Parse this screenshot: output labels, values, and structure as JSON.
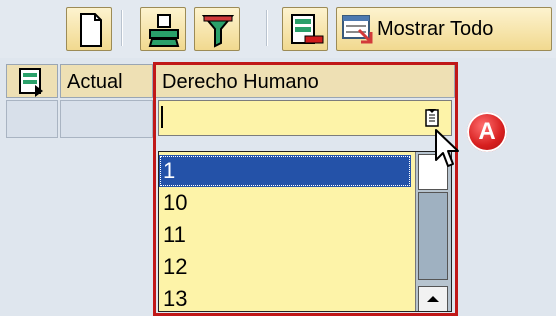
{
  "toolbar": {
    "buttons": [
      {
        "name": "new-document",
        "icon": "document-icon"
      },
      {
        "name": "print",
        "icon": "printer-icon"
      },
      {
        "name": "filter",
        "icon": "filter-icon"
      },
      {
        "name": "layout",
        "icon": "layout-icon"
      },
      {
        "name": "show-all",
        "icon": "show-all-icon",
        "label": "Mostrar Todo"
      }
    ]
  },
  "grid": {
    "columns": [
      "Actual",
      "Derecho Humano"
    ],
    "row_selector_icon": "row-select-icon"
  },
  "dropdown": {
    "value": "",
    "options": [
      "1",
      "10",
      "11",
      "12",
      "13"
    ],
    "selected": "1"
  },
  "annotation": {
    "badge": "A"
  },
  "colors": {
    "highlight_frame": "#c01818",
    "selection": "#2452a8",
    "field_bg": "#fdf3a8",
    "header_bg": "#eee0b4"
  }
}
